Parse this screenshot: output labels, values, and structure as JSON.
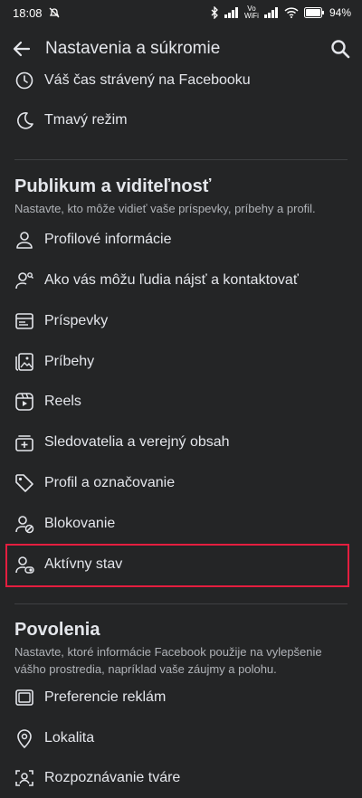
{
  "status_bar": {
    "time": "18:08",
    "network": "Vo\nWiFi",
    "battery": "94%"
  },
  "header": {
    "title": "Nastavenia a súkromie"
  },
  "top_items": [
    {
      "label": "Váš čas strávený na Facebooku",
      "icon": "clock-icon"
    },
    {
      "label": "Tmavý režim",
      "icon": "moon-icon"
    }
  ],
  "section_audience": {
    "title": "Publikum a viditeľnosť",
    "description": "Nastavte, kto môže vidieť vaše príspevky, príbehy a profil.",
    "items": [
      {
        "label": "Profilové informácie",
        "icon": "person-icon"
      },
      {
        "label": "Ako vás môžu ľudia nájsť a kontaktovať",
        "icon": "person-search-icon"
      },
      {
        "label": "Príspevky",
        "icon": "posts-icon"
      },
      {
        "label": "Príbehy",
        "icon": "stories-icon"
      },
      {
        "label": "Reels",
        "icon": "reels-icon"
      },
      {
        "label": "Sledovatelia a verejný obsah",
        "icon": "followers-icon"
      },
      {
        "label": "Profil a označovanie",
        "icon": "tag-icon"
      },
      {
        "label": "Blokovanie",
        "icon": "block-icon"
      },
      {
        "label": "Aktívny stav",
        "icon": "active-status-icon"
      }
    ]
  },
  "section_permissions": {
    "title": "Povolenia",
    "description": "Nastavte, ktoré informácie Facebook použije na vylepšenie vášho prostredia, napríklad vaše záujmy a polohu.",
    "items": [
      {
        "label": "Preferencie reklám",
        "icon": "ad-preferences-icon"
      },
      {
        "label": "Lokalita",
        "icon": "location-pin-icon"
      },
      {
        "label": "Rozpoznávanie tváre",
        "icon": "face-recognition-icon"
      }
    ]
  },
  "colors": {
    "background": "#242526",
    "text": "#e4e6eb",
    "secondary_text": "#b0b3b8",
    "divider": "#3e4042",
    "highlight": "#e41e3f"
  }
}
